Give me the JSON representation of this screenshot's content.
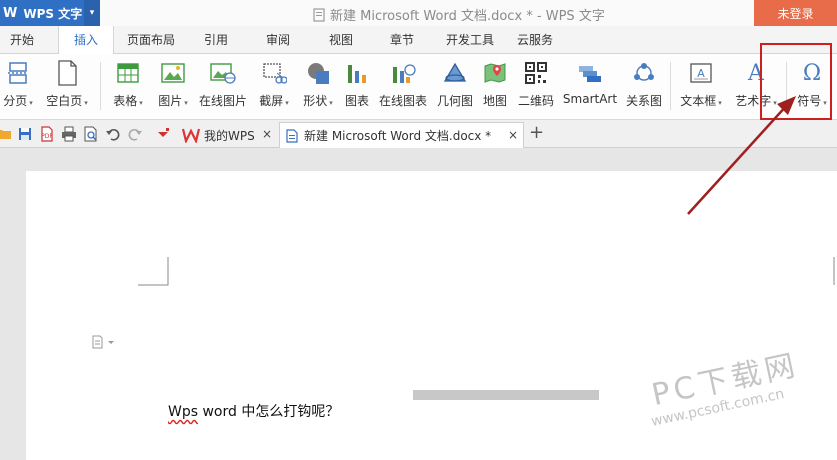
{
  "app": {
    "name": "WPS 文字",
    "logo": "W",
    "document_title": "新建 Microsoft Word 文档.docx * - WPS 文字",
    "login_label": "未登录",
    "colors": {
      "accent": "#2f6fc4",
      "login": "#e86c4a",
      "annotation": "#cc2020"
    }
  },
  "menu": {
    "tabs": [
      {
        "label": "开始",
        "active": false
      },
      {
        "label": "插入",
        "active": true
      },
      {
        "label": "页面布局",
        "active": false
      },
      {
        "label": "引用",
        "active": false
      },
      {
        "label": "审阅",
        "active": false
      },
      {
        "label": "视图",
        "active": false
      },
      {
        "label": "章节",
        "active": false
      },
      {
        "label": "开发工具",
        "active": false
      },
      {
        "label": "云服务",
        "active": false
      }
    ]
  },
  "ribbon": {
    "items": [
      {
        "label": "分页",
        "dropdown": true,
        "icon": "page-break-icon"
      },
      {
        "label": "空白页",
        "dropdown": true,
        "icon": "blank-page-icon"
      },
      {
        "label": "表格",
        "dropdown": true,
        "icon": "table-icon"
      },
      {
        "label": "图片",
        "dropdown": true,
        "icon": "picture-icon"
      },
      {
        "label": "在线图片",
        "dropdown": false,
        "icon": "online-picture-icon"
      },
      {
        "label": "截屏",
        "dropdown": true,
        "icon": "screenshot-icon"
      },
      {
        "label": "形状",
        "dropdown": true,
        "icon": "shape-icon"
      },
      {
        "label": "图表",
        "dropdown": false,
        "icon": "chart-icon"
      },
      {
        "label": "在线图表",
        "dropdown": false,
        "icon": "online-chart-icon"
      },
      {
        "label": "几何图",
        "dropdown": false,
        "icon": "geometry-icon"
      },
      {
        "label": "地图",
        "dropdown": false,
        "icon": "map-icon"
      },
      {
        "label": "二维码",
        "dropdown": false,
        "icon": "qrcode-icon"
      },
      {
        "label": "SmartArt",
        "dropdown": false,
        "icon": "smartart-icon"
      },
      {
        "label": "关系图",
        "dropdown": false,
        "icon": "relation-icon"
      },
      {
        "label": "文本框",
        "dropdown": true,
        "icon": "textbox-icon"
      },
      {
        "label": "艺术字",
        "dropdown": true,
        "icon": "wordart-icon"
      },
      {
        "label": "符号",
        "dropdown": true,
        "icon": "symbol-icon"
      }
    ],
    "dropdown_arrow": "▾",
    "symbol_glyph": "Ω",
    "wordart_glyph": "A"
  },
  "tabs": {
    "home_tab": "我的WPS",
    "doc_tab": "新建 Microsoft Word 文档.docx *",
    "close": "×",
    "add": "+"
  },
  "document": {
    "text_prefix": "Wps",
    "text_rest": " word 中怎么打钩呢？"
  },
  "watermark": {
    "line1": "PC下载网",
    "line2": "www.pcsoft.com.cn"
  }
}
